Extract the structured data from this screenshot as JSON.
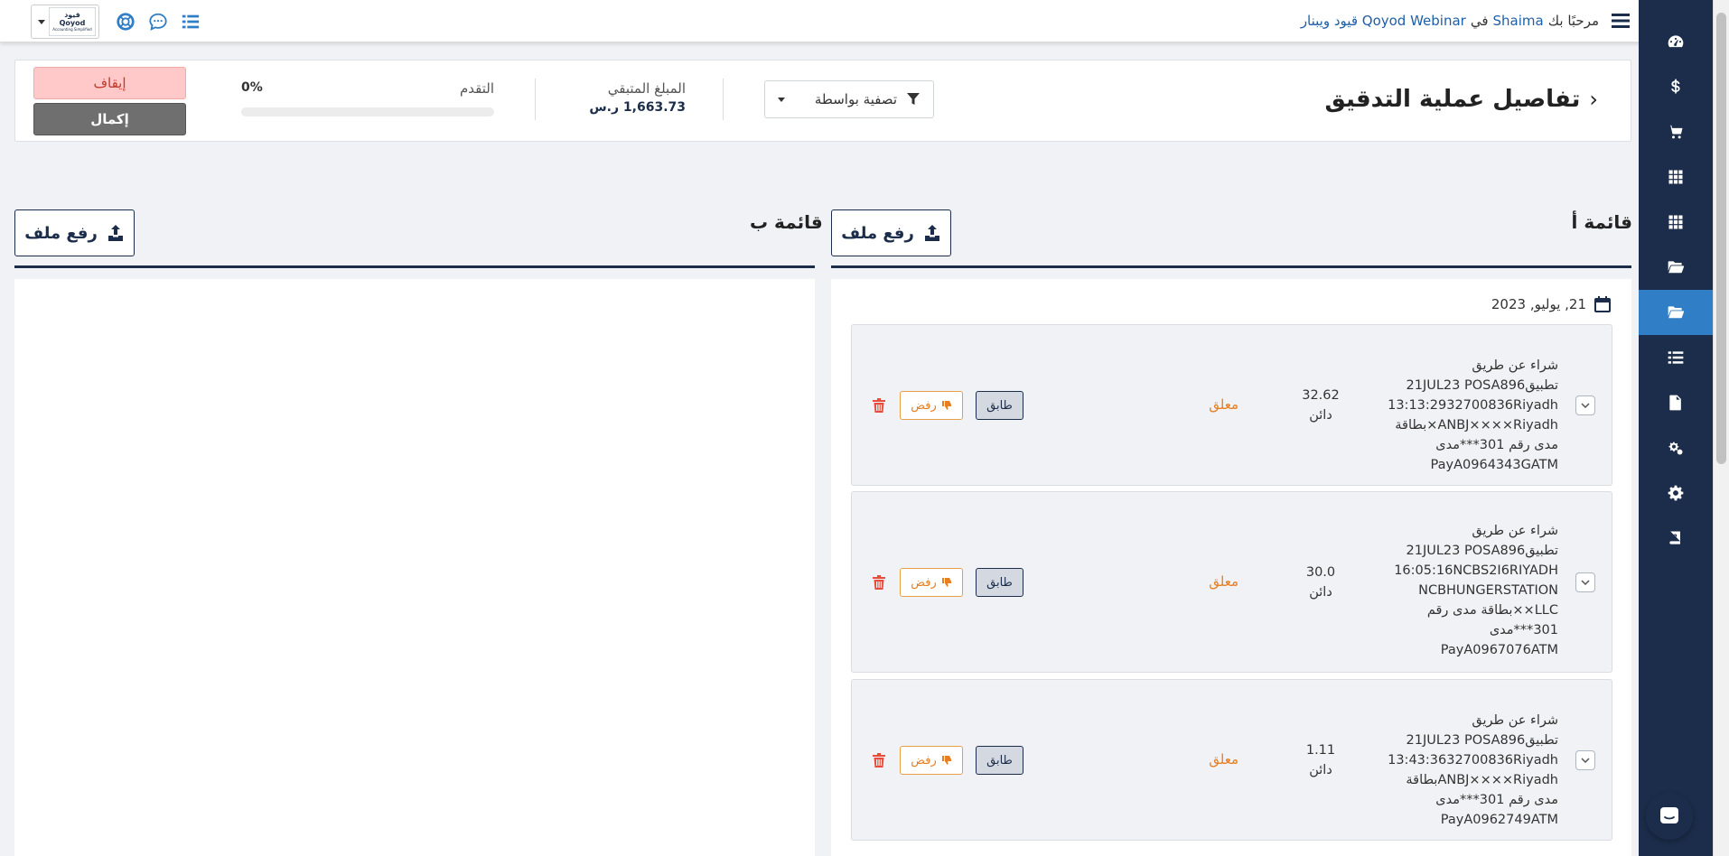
{
  "topbar": {
    "welcome_prefix": "مرحبًا بك",
    "user_name": "Shaima",
    "in_word": "في",
    "company": "Qoyod Webinar قيود ويبنار",
    "logo_text_en": "Qoyod",
    "logo_text_ar": "قيود",
    "logo_tagline": "Accounting Simplified"
  },
  "sidebar": {
    "items": [
      {
        "icon": "dashboard-icon"
      },
      {
        "icon": "dollar-icon"
      },
      {
        "icon": "cart-icon"
      },
      {
        "icon": "grid-icon"
      },
      {
        "icon": "grid-icon"
      },
      {
        "icon": "folder-open-icon"
      },
      {
        "icon": "folder-open-icon",
        "active": true
      },
      {
        "icon": "list-icon"
      },
      {
        "icon": "document-icon"
      },
      {
        "icon": "cogs-icon"
      },
      {
        "icon": "gear-icon"
      },
      {
        "icon": "help-icon"
      }
    ]
  },
  "header": {
    "title": "تفاصيل عملية التدقيق",
    "filter_label": "تصفية بواسطة",
    "remaining_label": "المبلغ المتبقي",
    "remaining_value": "1,663.73 ر.س",
    "progress_label": "التقدم",
    "progress_percent": "0%",
    "progress_fraction": 0,
    "stop_label": "إيقاف",
    "complete_label": "إكمال"
  },
  "list_a": {
    "title": "قائمة أ",
    "upload_label": "رفع ملف",
    "date": "21, يوليو, 2023",
    "transactions": [
      {
        "description": [
          "شراء عن طريق",
          "تطبيق21JUL23 POSA896",
          "13:13:2932700836Riyadh",
          "ANBJ××××Riyadh×بطاقة",
          "مدى رقم 301***مدى",
          "PayA0964343GATM"
        ],
        "amount": "32.62",
        "side": "دائن",
        "status": "معلق",
        "match_label": "طابق",
        "reject_label": "رفض"
      },
      {
        "description": [
          "شراء عن طريق",
          "تطبيق21JUL23 POSA896",
          "16:05:16NCBS2I6RIYADH",
          "NCBHUNGERSTATION",
          "LLC××بطاقة مدى رقم",
          "301***مدى",
          "PayA0967076ATM"
        ],
        "amount": "30.0",
        "side": "دائن",
        "status": "معلق",
        "match_label": "طابق",
        "reject_label": "رفض"
      },
      {
        "description": [
          "شراء عن طريق",
          "تطبيق21JUL23 POSA896",
          "13:43:3632700836Riyadh",
          "ANBJ××××Riyadhبطاقة",
          "مدى رقم 301***مدى",
          "PayA0962749ATM"
        ],
        "amount": "1.11",
        "side": "دائن",
        "status": "معلق",
        "match_label": "طابق",
        "reject_label": "رفض"
      }
    ]
  },
  "list_b": {
    "title": "قائمة ب",
    "upload_label": "رفع ملف"
  },
  "colors": {
    "sidebar": "#1b2d4b",
    "active": "#2f7ec6",
    "pending": "#e67e22",
    "danger": "#e74c3c"
  }
}
